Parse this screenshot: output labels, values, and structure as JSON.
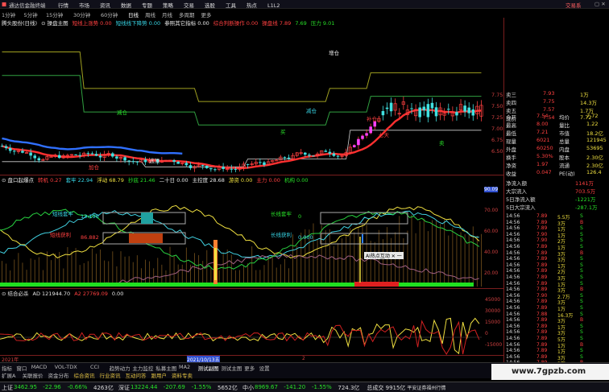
{
  "window": {
    "app_name": "通达信金融终端",
    "menus": [
      "行情",
      "市场",
      "资讯",
      "数据",
      "专题",
      "策略",
      "交易",
      "选股",
      "工具",
      "热点",
      "L1L2"
    ],
    "trade_label": "交易系"
  },
  "periods": [
    "1分钟",
    "5分钟",
    "15分钟",
    "30分钟",
    "60分钟",
    "日线",
    "周线",
    "月线",
    "多周期",
    "更多"
  ],
  "main_panel": {
    "stock": "腾头股份(日线)",
    "title": "操盘主图",
    "items": [
      {
        "text": "短线上涨势 0.00",
        "color": "#ff4040"
      },
      {
        "text": "短线线下降势 0.00",
        "color": "#38d8e8"
      },
      {
        "text": "参照其它指标 0.00",
        "color": "#e8e8e8"
      },
      {
        "text": "综合判断操作 0.00",
        "color": "#ff4040"
      },
      {
        "text": "操盘线 7.89",
        "color": "#ff4040"
      },
      {
        "text": "7.69",
        "color": "#28e028"
      },
      {
        "text": "压力 9.01",
        "color": "#28e028"
      }
    ],
    "annotations": [
      {
        "text": "减仓",
        "color": "#28e028"
      },
      {
        "text": "减仓",
        "color": "#38d8e8"
      },
      {
        "text": "补仓",
        "color": "#ff4040"
      },
      {
        "text": "增仓",
        "color": "#e8e8e8"
      },
      {
        "text": "买",
        "color": "#28e028"
      },
      {
        "text": "卖",
        "color": "#28e028"
      },
      {
        "text": "加仓",
        "color": "#ff4040"
      },
      {
        "text": "逃顶",
        "color": "#e8e8e8"
      },
      {
        "text": "七天",
        "color": "#ff4040"
      }
    ]
  },
  "mid_panel": {
    "title": "盘口起爆点",
    "items": [
      {
        "text": "转机 0.27",
        "color": "#ff4040"
      },
      {
        "text": "套牢 22.94",
        "color": "#38d8e8"
      },
      {
        "text": "浮动 68.79",
        "color": "#f0e040"
      },
      {
        "text": "抄底 21.46",
        "color": "#28e028"
      },
      {
        "text": "二十日 0.00",
        "color": "#e8e8e8"
      },
      {
        "text": "主控度 28.68",
        "color": "#e8e8e8"
      },
      {
        "text": "游资 0.00",
        "color": "#f0e040"
      },
      {
        "text": "主力 0.00",
        "color": "#ff4040"
      },
      {
        "text": "机构 0.00",
        "color": "#28e028"
      }
    ],
    "labels": [
      {
        "text": "短线套牢",
        "color": "#38d8e8"
      },
      {
        "text": "13.196",
        "color": "#38d8e8"
      },
      {
        "text": "短线获利",
        "color": "#ff4040"
      },
      {
        "text": "86.882",
        "color": "#ff4040"
      },
      {
        "text": "长线套牢",
        "color": "#28e028"
      },
      {
        "text": "0",
        "color": "#28e028"
      },
      {
        "text": "长线获利",
        "color": "#38d8e8"
      },
      {
        "text": "0.000",
        "color": "#38d8e8"
      }
    ],
    "tooltip": "AI热点互动",
    "axis": [
      "90.09",
      "70.00",
      "60.00",
      "40.00",
      "20.00"
    ]
  },
  "bot_panel": {
    "title": "结合必杀",
    "items": [
      {
        "text": "AD 121944.70",
        "color": "#e8e8e8"
      },
      {
        "text": "A2 27769.09",
        "color": "#ff4040"
      },
      {
        "text": "0.00",
        "color": "#e8e8e8"
      }
    ],
    "axis": [
      "45000",
      "30000",
      "15000",
      "0",
      "-15000"
    ]
  },
  "time_axis": [
    "2021年",
    "2021/10/13五",
    "2"
  ],
  "quote": {
    "rows": [
      {
        "label": "卖三",
        "price": "7.93",
        "vol": "1万",
        "pc": "#ff4040"
      },
      {
        "label": "卖四",
        "price": "7.75",
        "vol": "14.3万",
        "pc": "#ff4040"
      },
      {
        "label": "卖五",
        "price": "7.57",
        "vol": "1.7万",
        "pc": "#ff4040"
      },
      {
        "label": "现价",
        "price": "7.54",
        "vol": "7.72",
        "pc": "#ff4040"
      }
    ],
    "stats": [
      {
        "l": "今开",
        "v": "7.54",
        "l2": "均价",
        "v2": "7.72"
      },
      {
        "l": "最高",
        "v": "8.00",
        "l2": "量比",
        "v2": "1.22"
      },
      {
        "l": "最低",
        "v": "7.21",
        "l2": "市值",
        "v2": "18.2亿"
      },
      {
        "l": "现量",
        "v": "6021",
        "l2": "总量",
        "v2": "121945"
      },
      {
        "l": "外盘",
        "v": "60250",
        "l2": "内盘",
        "v2": "53695"
      },
      {
        "l": "换手",
        "v": "5.30%",
        "l2": "股本",
        "v2": "2.30亿"
      },
      {
        "l": "净资",
        "v": "1.97",
        "l2": "流通",
        "v2": "2.30亿"
      },
      {
        "l": "收益",
        "v": "0.047",
        "l2": "PE(动)",
        "v2": "126.4"
      }
    ],
    "flows": [
      {
        "l": "净流入额",
        "v": "1141万",
        "c": "#ff4040"
      },
      {
        "l": "大宗流入",
        "v": "703.5万",
        "c": "#ff4040"
      },
      {
        "l": "5日净流入额",
        "v": "-1221万",
        "c": "#28e028"
      },
      {
        "l": "5日大宗流入",
        "v": "-287.1万",
        "c": "#28e028"
      }
    ],
    "ticks": [
      [
        "14:56",
        "7.89",
        "5.5万",
        "S"
      ],
      [
        "14:56",
        "7.89",
        "3万",
        "B"
      ],
      [
        "14:56",
        "7.89",
        "1万",
        "S"
      ],
      [
        "14:56",
        "7.90",
        "1万",
        "S"
      ],
      [
        "14:56",
        "7.90",
        "2万",
        "S"
      ],
      [
        "14:56",
        "7.89",
        "1万",
        "S"
      ],
      [
        "14:56",
        "7.89",
        "3万",
        "B"
      ],
      [
        "14:56",
        "7.89",
        "3万",
        "S"
      ],
      [
        "14:56",
        "7.89",
        "1万",
        "S"
      ],
      [
        "14:56",
        "7.89",
        "2万",
        "S"
      ],
      [
        "14:56",
        "7.89",
        "3万",
        "S"
      ],
      [
        "14:56",
        "7.89",
        "1万",
        "S"
      ],
      [
        "14:56",
        "7.89",
        "3万",
        "B"
      ],
      [
        "14:56",
        "7.90",
        "2.7万",
        "S"
      ],
      [
        "14:56",
        "7.89",
        "3万",
        "S"
      ],
      [
        "14:56",
        "7.89",
        "1万",
        "S"
      ],
      [
        "14:56",
        "7.88",
        "16.3万",
        "S"
      ],
      [
        "14:56",
        "7.89",
        "3万",
        "B"
      ],
      [
        "14:56",
        "7.89",
        "1万",
        "S"
      ],
      [
        "14:56",
        "7.89",
        "3万",
        "S"
      ],
      [
        "14:56",
        "7.89",
        "5万",
        "S"
      ],
      [
        "14:56",
        "7.89",
        "1万",
        "B"
      ],
      [
        "14:56",
        "7.89",
        "1万",
        "S"
      ],
      [
        "14:56",
        "7.89",
        "3万",
        "S"
      ],
      [
        "14:56",
        "7.89",
        "3万",
        "B"
      ],
      [
        "14:56",
        "7.89",
        "1万",
        "S"
      ],
      [
        "14:56",
        "7.89",
        "1万",
        "S"
      ]
    ],
    "price_axis": [
      "7.75",
      "7.50",
      "7.25",
      "7.00",
      "6.75",
      "6.50"
    ]
  },
  "tabs": [
    "指标",
    "窗口",
    "MACD",
    "VOL-TDX",
    "CCI",
    "趋势动力",
    "主力监控",
    "私募主图",
    "MA2",
    "测试副图",
    "测试主图",
    "更多",
    "设置"
  ],
  "tabs2": [
    "扩展A",
    "关联报价",
    "资金分布",
    "综合资讯",
    "行业资讯",
    "互动问答",
    "跟用户",
    "资料专卖"
  ],
  "status": [
    {
      "name": "上证",
      "val": "3462.95",
      "chg": "-22.96",
      "pct": "-0.66%",
      "amt": "4263亿"
    },
    {
      "name": "深证",
      "val": "13224.44",
      "chg": "-207.69",
      "pct": "-1.55%",
      "amt": "5652亿"
    },
    {
      "name": "中小",
      "val": "8969.67",
      "chg": "-141.20",
      "pct": "-1.55%",
      "amt": "724.3亿"
    }
  ],
  "status_extra": {
    "total": "总成交",
    "total_val": "9915亿",
    "broker": "平安证券福州行情"
  },
  "watermark": "www.7gpzb.com"
}
